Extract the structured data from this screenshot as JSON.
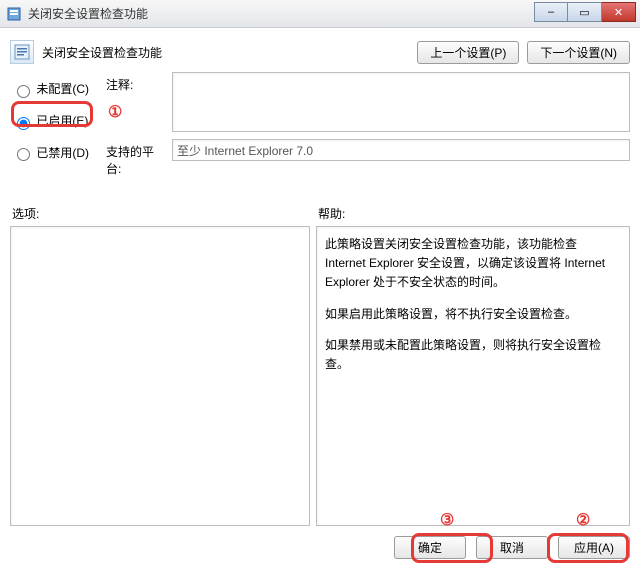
{
  "window": {
    "title": "关闭安全设置检查功能",
    "minimize_glyph": "–",
    "maximize_glyph": "▭",
    "close_glyph": "✕"
  },
  "header": {
    "heading": "关闭安全设置检查功能",
    "prev_button": "上一个设置(P)",
    "next_button": "下一个设置(N)"
  },
  "radios": {
    "not_configured": "未配置(C)",
    "enabled": "已启用(E)",
    "disabled": "已禁用(D)",
    "selected": "enabled"
  },
  "labels": {
    "comment": "注释:",
    "platform": "支持的平台:",
    "options": "选项:",
    "help": "帮助:"
  },
  "fields": {
    "comment_value": "",
    "platform_value": "至少 Internet Explorer 7.0"
  },
  "help": {
    "p1": "此策略设置关闭安全设置检查功能，该功能检查 Internet Explorer 安全设置，以确定该设置将 Internet Explorer 处于不安全状态的时间。",
    "p2": "如果启用此策略设置，将不执行安全设置检查。",
    "p3": "如果禁用或未配置此策略设置，则将执行安全设置检查。"
  },
  "footer": {
    "ok": "确定",
    "cancel": "取消",
    "apply": "应用(A)"
  },
  "callouts": {
    "c1": "①",
    "c2": "②",
    "c3": "③"
  }
}
